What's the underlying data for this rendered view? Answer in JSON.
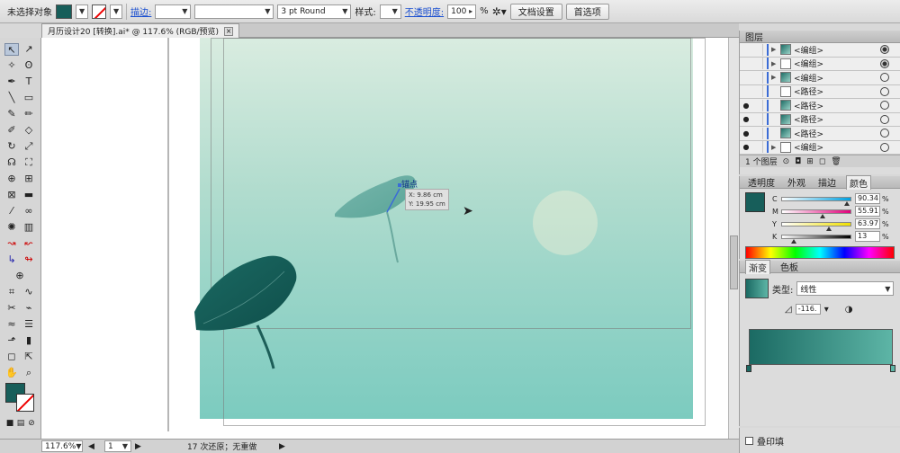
{
  "control_bar": {
    "selection_label": "未选择对象",
    "stroke_link": "描边:",
    "brush_value": "3 pt Round",
    "style_label": "样式:",
    "opacity_link": "不透明度:",
    "opacity_value": "100",
    "opacity_unit": "%",
    "doc_setup_button": "文档设置",
    "prefs_button": "首选项",
    "fill_color": "#175e5a"
  },
  "document_tab": {
    "title": "月历设计20 [转换].ai* @ 117.6% (RGB/预览)",
    "close": "×"
  },
  "canvas": {
    "anchor_label": "锚点",
    "tooltip_x": "X: 9.86 cm",
    "tooltip_y": "Y: 19.95 cm"
  },
  "status_bar": {
    "zoom": "117.6%",
    "artboard": "1",
    "undo_info": "17 次还原；无重做"
  },
  "layers_panel": {
    "title": "图层",
    "rows": [
      {
        "name": "<编组>",
        "vis": "",
        "expand": "▶",
        "thumb": "g",
        "target_on": true
      },
      {
        "name": "<编组>",
        "vis": "",
        "expand": "▶",
        "thumb": "w",
        "target_on": true
      },
      {
        "name": "<编组>",
        "vis": "",
        "expand": "▶",
        "thumb": "g",
        "target_on": false
      },
      {
        "name": "<路径>",
        "vis": "",
        "expand": "",
        "thumb": "w",
        "target_on": false
      },
      {
        "name": "<路径>",
        "vis": "●",
        "expand": "",
        "thumb": "g",
        "target_on": false
      },
      {
        "name": "<路径>",
        "vis": "●",
        "expand": "",
        "thumb": "g",
        "target_on": false
      },
      {
        "name": "<路径>",
        "vis": "●",
        "expand": "",
        "thumb": "g",
        "target_on": false
      },
      {
        "name": "<编组>",
        "vis": "●",
        "expand": "▶",
        "thumb": "w",
        "target_on": false
      }
    ],
    "footer": "1 个图层"
  },
  "color_panel": {
    "tabs": [
      "透明度",
      "外观",
      "描边",
      "颜色"
    ],
    "selected_tab": "颜色",
    "channels": [
      {
        "ch": "C",
        "value": "90.34",
        "pct": 0.9034
      },
      {
        "ch": "M",
        "value": "55.91",
        "pct": 0.5591
      },
      {
        "ch": "Y",
        "value": "63.97",
        "pct": 0.6397
      },
      {
        "ch": "K",
        "value": "13",
        "pct": 0.13
      }
    ],
    "unit": "%"
  },
  "gradient_panel": {
    "tabs": [
      "渐变",
      "色板"
    ],
    "selected_tab": "渐变",
    "type_label": "类型:",
    "type_value": "线性",
    "angle_value": "-116.",
    "start_color": "#1b6a63",
    "end_color": "#5db5a6"
  },
  "bottom_panel": {
    "overprint_label": "叠印填"
  }
}
